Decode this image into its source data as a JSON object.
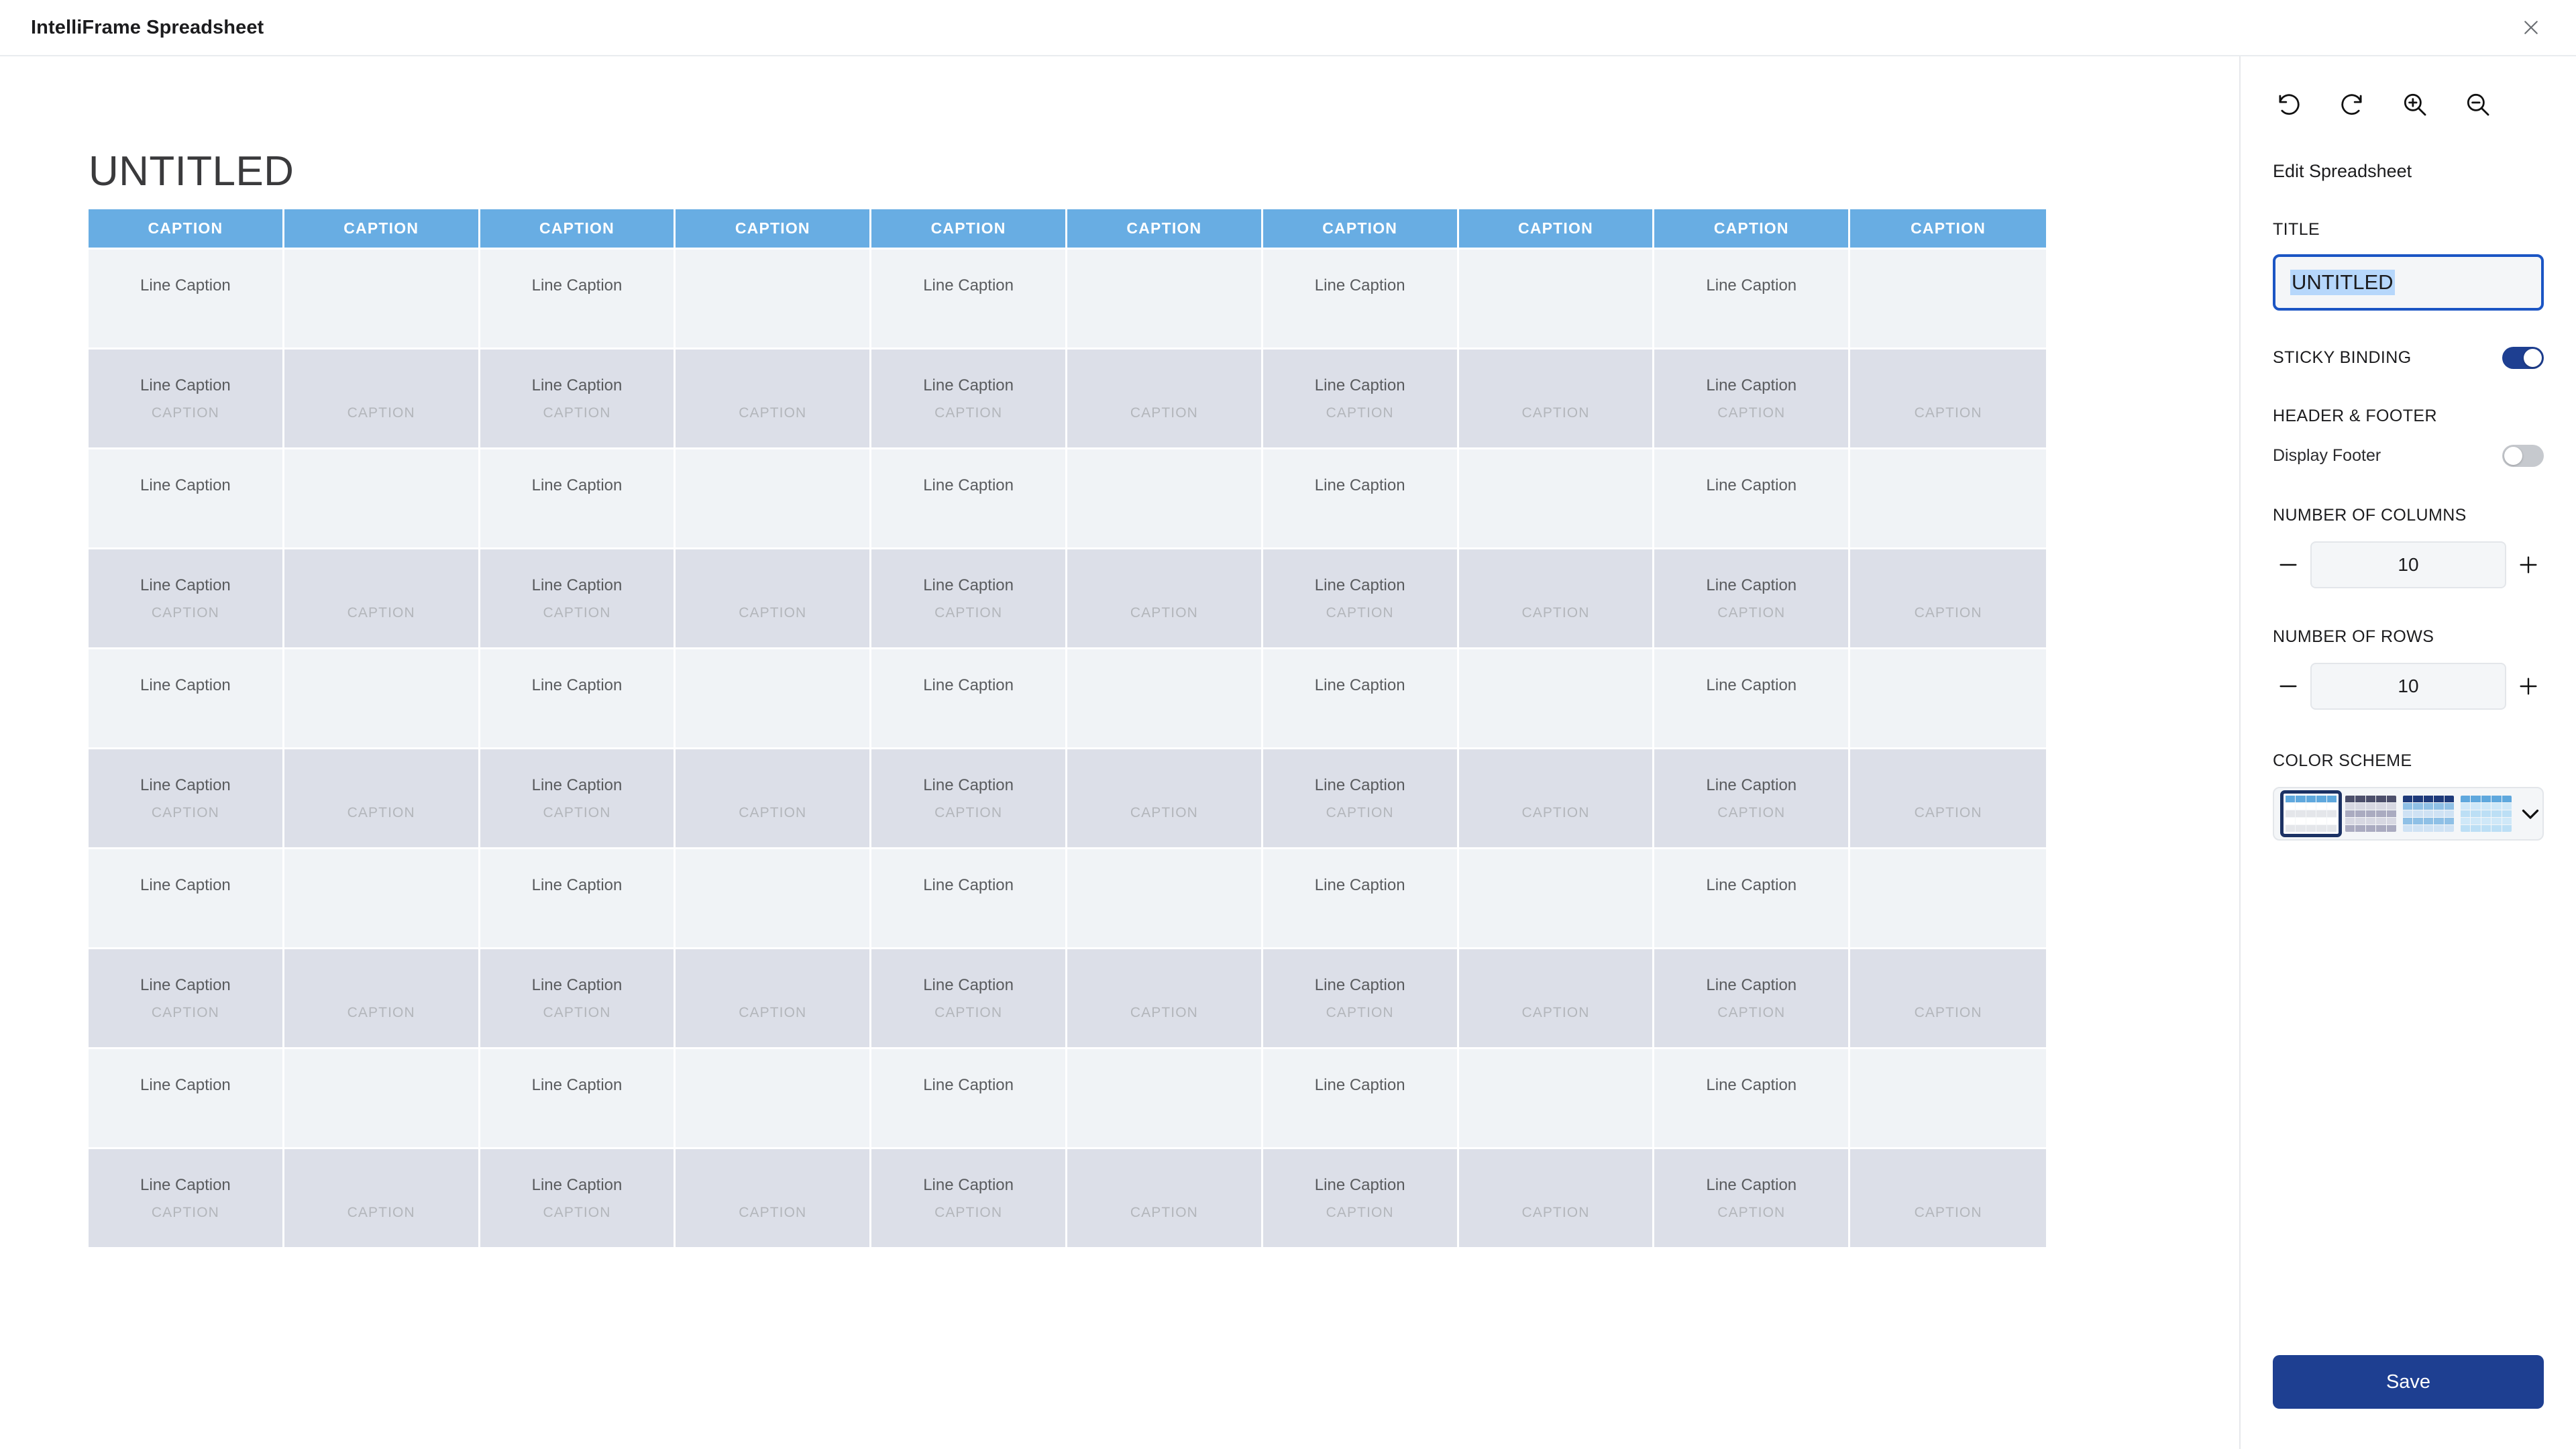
{
  "window": {
    "app_title": "IntelliFrame Spreadsheet",
    "close_icon": "close-icon"
  },
  "canvas": {
    "document_title": "UNTITLED"
  },
  "sheet": {
    "column_count": 10,
    "row_count": 10,
    "header_label": "CAPTION",
    "headers": [
      "CAPTION",
      "CAPTION",
      "CAPTION",
      "CAPTION",
      "CAPTION",
      "CAPTION",
      "CAPTION",
      "CAPTION",
      "CAPTION",
      "CAPTION"
    ],
    "cell_primary_label": "Line Caption",
    "cell_secondary_label": "CAPTION",
    "rows": [
      {
        "style": "light",
        "cells": [
          "Line Caption",
          "",
          "Line Caption",
          "",
          "Line Caption",
          "",
          "Line Caption",
          "",
          "Line Caption",
          ""
        ],
        "sub": [
          "",
          "",
          "",
          "",
          "",
          "",
          "",
          "",
          "",
          ""
        ]
      },
      {
        "style": "dark",
        "cells": [
          "Line Caption",
          "",
          "Line Caption",
          "",
          "Line Caption",
          "",
          "Line Caption",
          "",
          "Line Caption",
          ""
        ],
        "sub": [
          "CAPTION",
          "CAPTION",
          "CAPTION",
          "CAPTION",
          "CAPTION",
          "CAPTION",
          "CAPTION",
          "CAPTION",
          "CAPTION",
          "CAPTION"
        ]
      },
      {
        "style": "light",
        "cells": [
          "Line Caption",
          "",
          "Line Caption",
          "",
          "Line Caption",
          "",
          "Line Caption",
          "",
          "Line Caption",
          ""
        ],
        "sub": [
          "",
          "",
          "",
          "",
          "",
          "",
          "",
          "",
          "",
          ""
        ]
      },
      {
        "style": "dark",
        "cells": [
          "Line Caption",
          "",
          "Line Caption",
          "",
          "Line Caption",
          "",
          "Line Caption",
          "",
          "Line Caption",
          ""
        ],
        "sub": [
          "CAPTION",
          "CAPTION",
          "CAPTION",
          "CAPTION",
          "CAPTION",
          "CAPTION",
          "CAPTION",
          "CAPTION",
          "CAPTION",
          "CAPTION"
        ]
      },
      {
        "style": "light",
        "cells": [
          "Line Caption",
          "",
          "Line Caption",
          "",
          "Line Caption",
          "",
          "Line Caption",
          "",
          "Line Caption",
          ""
        ],
        "sub": [
          "",
          "",
          "",
          "",
          "",
          "",
          "",
          "",
          "",
          ""
        ]
      },
      {
        "style": "dark",
        "cells": [
          "Line Caption",
          "",
          "Line Caption",
          "",
          "Line Caption",
          "",
          "Line Caption",
          "",
          "Line Caption",
          ""
        ],
        "sub": [
          "CAPTION",
          "CAPTION",
          "CAPTION",
          "CAPTION",
          "CAPTION",
          "CAPTION",
          "CAPTION",
          "CAPTION",
          "CAPTION",
          "CAPTION"
        ]
      },
      {
        "style": "light",
        "cells": [
          "Line Caption",
          "",
          "Line Caption",
          "",
          "Line Caption",
          "",
          "Line Caption",
          "",
          "Line Caption",
          ""
        ],
        "sub": [
          "",
          "",
          "",
          "",
          "",
          "",
          "",
          "",
          "",
          ""
        ]
      },
      {
        "style": "dark",
        "cells": [
          "Line Caption",
          "",
          "Line Caption",
          "",
          "Line Caption",
          "",
          "Line Caption",
          "",
          "Line Caption",
          ""
        ],
        "sub": [
          "CAPTION",
          "CAPTION",
          "CAPTION",
          "CAPTION",
          "CAPTION",
          "CAPTION",
          "CAPTION",
          "CAPTION",
          "CAPTION",
          "CAPTION"
        ]
      },
      {
        "style": "light",
        "cells": [
          "Line Caption",
          "",
          "Line Caption",
          "",
          "Line Caption",
          "",
          "Line Caption",
          "",
          "Line Caption",
          ""
        ],
        "sub": [
          "",
          "",
          "",
          "",
          "",
          "",
          "",
          "",
          "",
          ""
        ]
      },
      {
        "style": "dark",
        "cells": [
          "Line Caption",
          "",
          "Line Caption",
          "",
          "Line Caption",
          "",
          "Line Caption",
          "",
          "Line Caption",
          ""
        ],
        "sub": [
          "CAPTION",
          "CAPTION",
          "CAPTION",
          "CAPTION",
          "CAPTION",
          "CAPTION",
          "CAPTION",
          "CAPTION",
          "CAPTION",
          "CAPTION"
        ]
      }
    ],
    "colors": {
      "header_bg": "#68ade3",
      "header_text": "#ffffff",
      "row_light_bg": "#f0f3f6",
      "row_dark_bg": "#dcdfe8",
      "cell_text": "#595b5e",
      "sub_text": "#b3b6bb"
    }
  },
  "panel": {
    "heading": "Edit Spreadsheet",
    "toolbar": [
      {
        "name": "undo-icon",
        "label": "Undo"
      },
      {
        "name": "redo-icon",
        "label": "Redo"
      },
      {
        "name": "zoom-in-icon",
        "label": "Zoom In"
      },
      {
        "name": "zoom-out-icon",
        "label": "Zoom Out"
      }
    ],
    "title_section": {
      "label": "TITLE",
      "value": "UNTITLED",
      "placeholder": "UNTITLED"
    },
    "sticky_binding": {
      "label": "STICKY BINDING",
      "state": "on"
    },
    "header_footer": {
      "label": "HEADER & FOOTER",
      "display_footer_label": "Display Footer",
      "display_footer_state": "off"
    },
    "columns": {
      "label": "NUMBER OF COLUMNS",
      "value": "10",
      "decrement_icon": "minus-icon",
      "increment_icon": "plus-icon"
    },
    "rows": {
      "label": "NUMBER OF ROWS",
      "value": "10",
      "decrement_icon": "minus-icon",
      "increment_icon": "plus-icon"
    },
    "color_scheme": {
      "label": "COLOR SCHEME",
      "selected_index": 0,
      "chevron_icon": "chevron-down-icon",
      "options": [
        {
          "name": "blue-light",
          "header": "#5fa8dd",
          "row_a": "#ffffff",
          "row_b": "#e4e6ea",
          "selected": true
        },
        {
          "name": "slate-purple",
          "header": "#4c4f6b",
          "row_a": "#d7d8e2",
          "row_b": "#aaabc0",
          "selected": false
        },
        {
          "name": "navy-blue",
          "header": "#1e3a7a",
          "row_a": "#8fc0e6",
          "row_b": "#cfe2f4",
          "selected": false
        },
        {
          "name": "sky-pale",
          "header": "#5fa8dd",
          "row_a": "#cfe8f8",
          "row_b": "#bcdff5",
          "selected": false
        }
      ]
    },
    "save_button": {
      "label": "Save",
      "color": "#1e3f91"
    }
  }
}
